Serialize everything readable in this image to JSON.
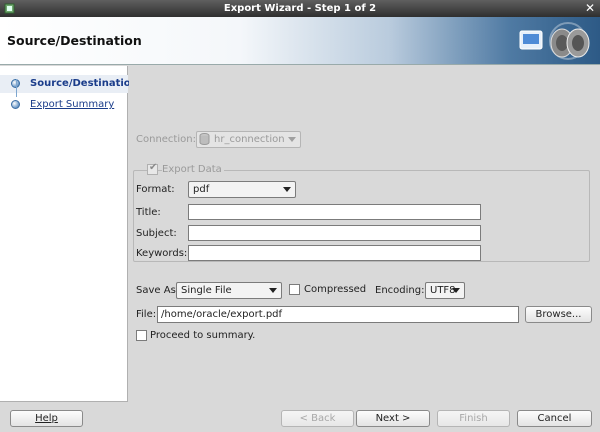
{
  "window": {
    "title": "Export Wizard - Step 1 of 2"
  },
  "header": {
    "title": "Source/Destination"
  },
  "nav": {
    "items": [
      {
        "label": "Source/Destination",
        "active": true
      },
      {
        "label": "Export Summary",
        "active": false
      }
    ]
  },
  "connection": {
    "label": "Connection:",
    "value": "hr_connection"
  },
  "export_data": {
    "label": "Export Data",
    "checked": true
  },
  "format": {
    "label": "Format:",
    "value": "pdf"
  },
  "fields": {
    "title_label": "Title:",
    "title_value": "",
    "subject_label": "Subject:",
    "subject_value": "",
    "keywords_label": "Keywords:",
    "keywords_value": ""
  },
  "save_as": {
    "label": "Save As",
    "value": "Single File"
  },
  "compressed": {
    "label": "Compressed",
    "checked": false
  },
  "encoding": {
    "label": "Encoding:",
    "value": "UTF8"
  },
  "file": {
    "label": "File:",
    "value": "/home/oracle/export.pdf",
    "browse_label": "Browse..."
  },
  "proceed": {
    "label": "Proceed to summary.",
    "checked": false
  },
  "buttons": {
    "help": "Help",
    "back": "< Back",
    "next": "Next >",
    "finish": "Finish",
    "cancel": "Cancel"
  },
  "colors": {
    "nav_link": "#1a3c8a",
    "header_accent": "#2d5a86",
    "disabled_text": "#9a9a9a"
  }
}
